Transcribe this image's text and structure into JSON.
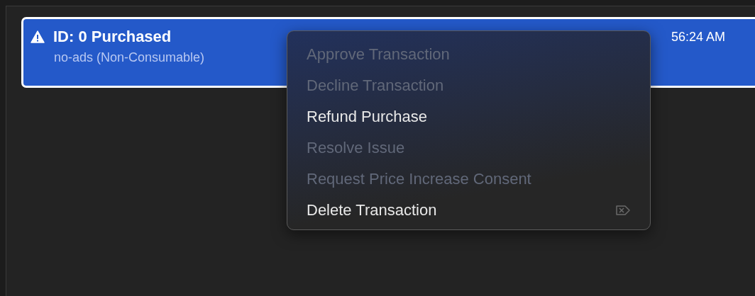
{
  "transaction": {
    "title": "ID: 0 Purchased",
    "subtitle": "no-ads (Non-Consumable)",
    "time": "56:24 AM",
    "selected": true
  },
  "context_menu": {
    "items": [
      {
        "label": "Approve Transaction",
        "disabled": true,
        "kind": "plain"
      },
      {
        "label": "Decline Transaction",
        "disabled": true,
        "kind": "plain"
      },
      {
        "label": "Refund Purchase",
        "disabled": false,
        "kind": "plain"
      },
      {
        "label": "Resolve Issue",
        "disabled": true,
        "kind": "plain"
      },
      {
        "label": "Request Price Increase Consent",
        "disabled": true,
        "kind": "plain"
      },
      {
        "label": "Delete Transaction",
        "disabled": false,
        "kind": "delete-key"
      }
    ]
  }
}
